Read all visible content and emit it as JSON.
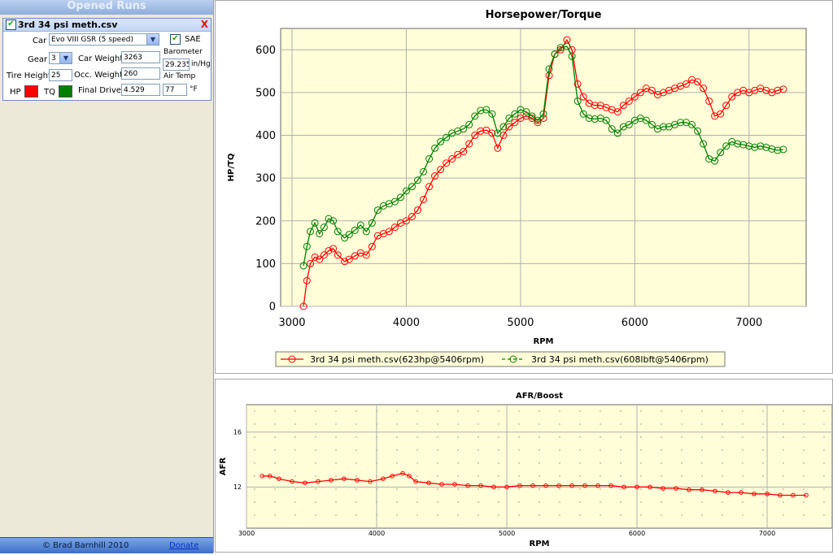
{
  "sidebar": {
    "header": "Opened Runs",
    "run": {
      "title": "3rd 34 psi meth.csv",
      "close": "X",
      "car_label": "Car",
      "car_value": "Evo VIII GSR (5 speed)",
      "sae_label": "SAE",
      "gear_label": "Gear",
      "gear_value": "3",
      "car_weight_label": "Car Weight",
      "car_weight_value": "3263",
      "barometer_label": "Barometer",
      "barometer_value": "29.235",
      "barometer_unit": "in/Hg",
      "tire_height_label": "Tire Height",
      "tire_height_value": "25",
      "occ_weight_label": "Occ. Weight",
      "occ_weight_value": "260",
      "air_temp_label": "Air Temp",
      "hp_label": "HP",
      "tq_label": "TQ",
      "final_drive_label": "Final Drive",
      "final_drive_value": "4.529",
      "air_temp_value": "77",
      "air_temp_unit": "°F",
      "hp_color": "#ff0000",
      "tq_color": "#008000"
    },
    "footer": {
      "copyright": "© Brad Barnhill 2010",
      "donate": "Donate"
    }
  },
  "chart_data": [
    {
      "type": "line",
      "title": "Horsepower/Torque",
      "xlabel": "RPM",
      "ylabel": "HP/TQ",
      "xlim": [
        2900,
        7500
      ],
      "ylim": [
        0,
        650
      ],
      "xticks": [
        3000,
        4000,
        5000,
        6000,
        7000
      ],
      "yticks": [
        0,
        100,
        200,
        300,
        400,
        500,
        600
      ],
      "grid": true,
      "legend_position": "bottom",
      "series": [
        {
          "name": "3rd 34 psi meth.csv(623hp@5406rpm)",
          "color": "#ff0000",
          "x": [
            3100,
            3130,
            3160,
            3200,
            3240,
            3280,
            3320,
            3360,
            3400,
            3460,
            3500,
            3550,
            3600,
            3650,
            3700,
            3750,
            3800,
            3850,
            3900,
            3950,
            4000,
            4050,
            4100,
            4150,
            4200,
            4250,
            4300,
            4350,
            4400,
            4450,
            4500,
            4550,
            4600,
            4650,
            4700,
            4750,
            4800,
            4850,
            4900,
            4950,
            5000,
            5050,
            5100,
            5150,
            5200,
            5250,
            5300,
            5350,
            5406,
            5450,
            5500,
            5550,
            5600,
            5650,
            5700,
            5750,
            5800,
            5850,
            5900,
            5950,
            6000,
            6050,
            6100,
            6150,
            6200,
            6250,
            6300,
            6350,
            6400,
            6450,
            6500,
            6550,
            6600,
            6650,
            6700,
            6750,
            6800,
            6850,
            6900,
            6950,
            7000,
            7050,
            7100,
            7150,
            7200,
            7250,
            7300
          ],
          "y": [
            0,
            60,
            100,
            115,
            110,
            120,
            130,
            135,
            120,
            105,
            110,
            118,
            125,
            120,
            140,
            165,
            170,
            175,
            185,
            195,
            200,
            210,
            225,
            250,
            280,
            305,
            320,
            335,
            345,
            355,
            362,
            380,
            400,
            410,
            412,
            405,
            370,
            400,
            420,
            430,
            440,
            445,
            440,
            430,
            440,
            540,
            590,
            600,
            623,
            600,
            520,
            490,
            475,
            470,
            470,
            465,
            460,
            455,
            470,
            480,
            490,
            500,
            510,
            505,
            495,
            500,
            505,
            510,
            515,
            520,
            530,
            525,
            510,
            480,
            445,
            450,
            470,
            490,
            500,
            505,
            500,
            505,
            510,
            505,
            500,
            505,
            508
          ]
        },
        {
          "name": "3rd 34 psi meth.csv(608lbft@5406rpm)",
          "color": "#008000",
          "x": [
            3100,
            3130,
            3160,
            3200,
            3240,
            3280,
            3320,
            3360,
            3400,
            3460,
            3500,
            3550,
            3600,
            3650,
            3700,
            3750,
            3800,
            3850,
            3900,
            3950,
            4000,
            4050,
            4100,
            4150,
            4200,
            4250,
            4300,
            4350,
            4400,
            4450,
            4500,
            4550,
            4600,
            4650,
            4700,
            4750,
            4800,
            4850,
            4900,
            4950,
            5000,
            5050,
            5100,
            5150,
            5200,
            5250,
            5300,
            5350,
            5406,
            5450,
            5500,
            5550,
            5600,
            5650,
            5700,
            5750,
            5800,
            5850,
            5900,
            5950,
            6000,
            6050,
            6100,
            6150,
            6200,
            6250,
            6300,
            6350,
            6400,
            6450,
            6500,
            6550,
            6600,
            6650,
            6700,
            6750,
            6800,
            6850,
            6900,
            6950,
            7000,
            7050,
            7100,
            7150,
            7200,
            7250,
            7300
          ],
          "y": [
            95,
            140,
            175,
            195,
            170,
            185,
            205,
            200,
            175,
            160,
            168,
            178,
            190,
            175,
            195,
            225,
            235,
            240,
            245,
            255,
            270,
            280,
            295,
            315,
            345,
            370,
            385,
            395,
            405,
            410,
            415,
            425,
            445,
            458,
            460,
            450,
            405,
            420,
            440,
            450,
            460,
            455,
            445,
            435,
            450,
            555,
            590,
            605,
            608,
            585,
            480,
            450,
            440,
            438,
            440,
            435,
            415,
            405,
            420,
            425,
            435,
            440,
            435,
            425,
            415,
            420,
            420,
            425,
            430,
            430,
            425,
            410,
            380,
            345,
            340,
            360,
            375,
            385,
            380,
            378,
            375,
            372,
            375,
            372,
            368,
            365,
            367
          ]
        }
      ]
    },
    {
      "type": "line",
      "title": "AFR/Boost",
      "xlabel": "RPM",
      "ylabel": "AFR",
      "xlim": [
        3000,
        7500
      ],
      "ylim": [
        9,
        18
      ],
      "xticks": [
        3000,
        4000,
        5000,
        6000,
        7000
      ],
      "yticks": [
        12,
        16
      ],
      "grid": true,
      "series": [
        {
          "color": "#ff0000",
          "x": [
            3120,
            3180,
            3250,
            3350,
            3450,
            3550,
            3650,
            3750,
            3850,
            3950,
            4050,
            4120,
            4200,
            4250,
            4300,
            4400,
            4500,
            4600,
            4700,
            4800,
            4900,
            5000,
            5100,
            5200,
            5300,
            5400,
            5500,
            5600,
            5700,
            5800,
            5900,
            6000,
            6100,
            6200,
            6300,
            6400,
            6500,
            6600,
            6700,
            6800,
            6900,
            7000,
            7100,
            7200,
            7300
          ],
          "y": [
            12.8,
            12.8,
            12.6,
            12.4,
            12.3,
            12.4,
            12.5,
            12.6,
            12.5,
            12.4,
            12.6,
            12.8,
            13.0,
            12.8,
            12.4,
            12.3,
            12.2,
            12.2,
            12.1,
            12.1,
            12.0,
            12.0,
            12.1,
            12.1,
            12.1,
            12.1,
            12.1,
            12.1,
            12.1,
            12.1,
            12.0,
            12.0,
            12.0,
            11.9,
            11.9,
            11.8,
            11.8,
            11.7,
            11.6,
            11.6,
            11.5,
            11.5,
            11.4,
            11.4,
            11.4
          ]
        }
      ]
    }
  ]
}
